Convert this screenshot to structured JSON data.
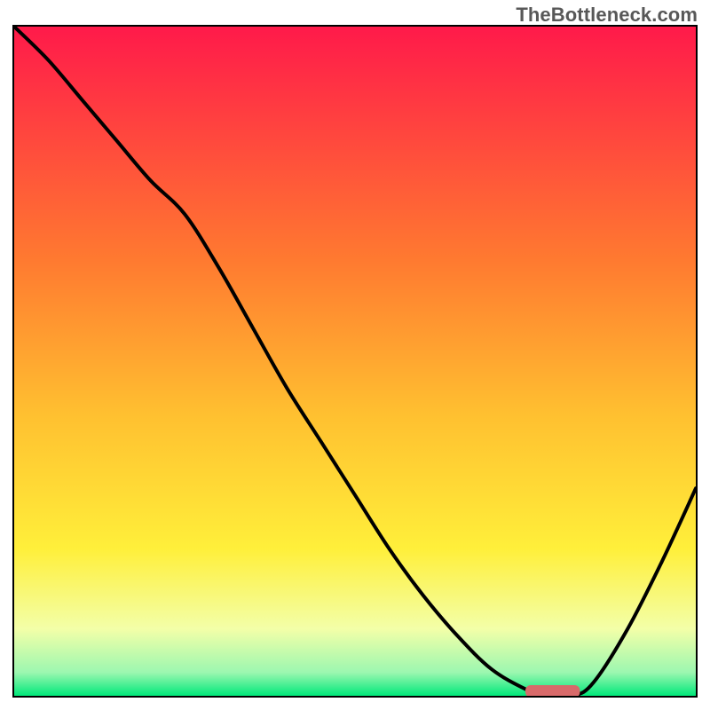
{
  "attribution": "TheBottleneck.com",
  "colors": {
    "gradient_top": "#ff1a4a",
    "gradient_mid_orange": "#ff8a2b",
    "gradient_mid_yellow": "#ffe438",
    "gradient_pale": "#f7ffb0",
    "gradient_green": "#00e87a",
    "curve": "#000000",
    "marker": "#d86a6a",
    "frame": "#000000"
  },
  "chart_data": {
    "type": "line",
    "title": "",
    "xlabel": "",
    "ylabel": "",
    "xlim": [
      0,
      100
    ],
    "ylim": [
      0,
      100
    ],
    "series": [
      {
        "name": "bottleneck-curve",
        "x": [
          0,
          5,
          10,
          15,
          20,
          25,
          30,
          35,
          40,
          45,
          50,
          55,
          60,
          65,
          70,
          75,
          78,
          82,
          85,
          90,
          95,
          100
        ],
        "y": [
          100,
          95,
          89,
          83,
          77,
          72,
          64,
          55,
          46,
          38,
          30,
          22,
          15,
          9,
          4,
          1,
          0,
          0,
          2,
          10,
          20,
          31
        ]
      }
    ],
    "marker": {
      "name": "optimal-range",
      "x_start": 75,
      "x_end": 83,
      "y": 0
    },
    "gradient_stops": [
      {
        "pos": 0.0,
        "color": "#ff1a4a"
      },
      {
        "pos": 0.35,
        "color": "#ff7a30"
      },
      {
        "pos": 0.58,
        "color": "#ffc030"
      },
      {
        "pos": 0.78,
        "color": "#ffef3a"
      },
      {
        "pos": 0.9,
        "color": "#f3ffa8"
      },
      {
        "pos": 0.965,
        "color": "#9cf7b0"
      },
      {
        "pos": 1.0,
        "color": "#00e87a"
      }
    ]
  }
}
